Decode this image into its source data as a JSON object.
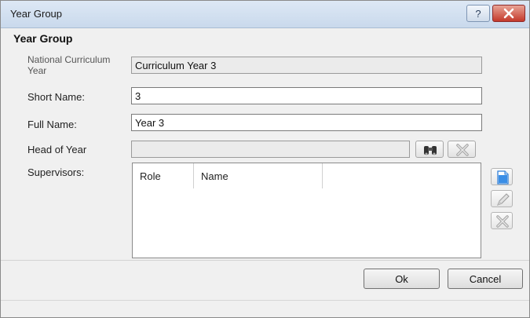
{
  "window": {
    "title": "Year Group",
    "help_label": "?",
    "close_label": "close"
  },
  "form": {
    "section_title": "Year Group",
    "national_curriculum_year": {
      "label": "National Curriculum Year",
      "value": "Curriculum Year 3"
    },
    "short_name": {
      "label": "Short Name:",
      "value": "3"
    },
    "full_name": {
      "label": "Full Name:",
      "value": "Year 3"
    },
    "head_of_year": {
      "label": "Head of Year",
      "value": "",
      "search_icon": "binoculars-icon",
      "clear_icon": "delete-x-icon"
    },
    "supervisors": {
      "label": "Supervisors:",
      "columns": [
        "Role",
        "Name",
        ""
      ],
      "rows": [],
      "actions": [
        "new-document-icon",
        "edit-pencil-icon",
        "delete-x-icon"
      ]
    }
  },
  "buttons": {
    "ok": "Ok",
    "cancel": "Cancel"
  },
  "colors": {
    "close_button": "#c4392b",
    "titlebar": "#c9d9ec",
    "new_icon": "#3a8ee6"
  }
}
